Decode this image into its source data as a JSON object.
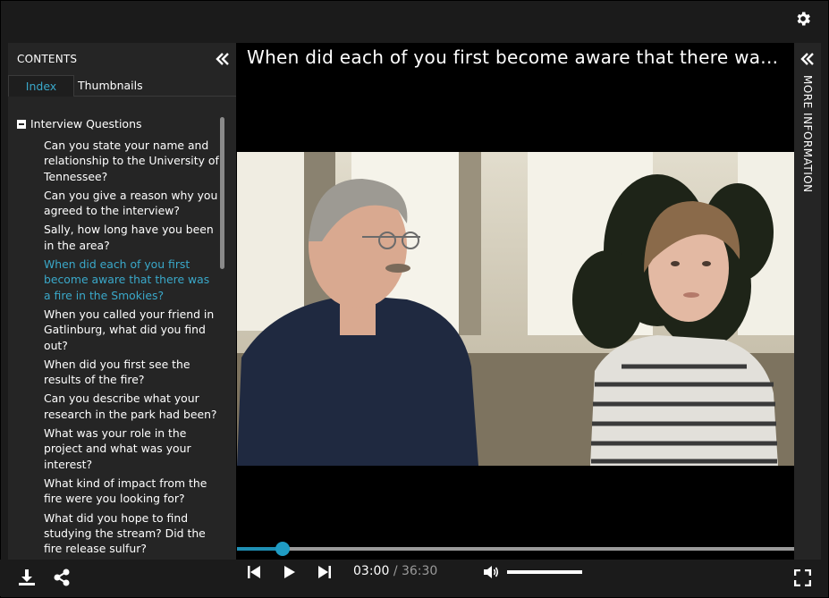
{
  "header": {
    "settings_icon": "gear-icon"
  },
  "sidebar": {
    "heading": "CONTENTS",
    "tabs": [
      {
        "label": "Index",
        "active": true
      },
      {
        "label": "Thumbnails",
        "active": false
      }
    ],
    "group": "Interview Questions",
    "items": [
      {
        "label": "Can you state your name and relationship to the University of Tennessee?",
        "active": false
      },
      {
        "label": "Can you give a reason why you agreed to the interview?",
        "active": false
      },
      {
        "label": "Sally, how long have you been in the area?",
        "active": false
      },
      {
        "label": "When did each of you first become aware that there was a fire in the Smokies?",
        "active": true
      },
      {
        "label": "When you called your friend in Gatlinburg, what did you find out?",
        "active": false
      },
      {
        "label": "When did you first see the results of the fire?",
        "active": false
      },
      {
        "label": "Can you describe what your research in the park had been?",
        "active": false
      },
      {
        "label": "What was your role in the project and what was your interest?",
        "active": false
      },
      {
        "label": "What kind of impact from the fire were you looking for?",
        "active": false
      },
      {
        "label": "What did you hope to find studying the stream? Did the fire release sulfur?",
        "active": false
      }
    ]
  },
  "main": {
    "title": "When did each of you first become aware that there wa..."
  },
  "info_panel": {
    "label": "MORE INFORMATION"
  },
  "player": {
    "current_time": "03:00",
    "separator": "/",
    "duration": "36:30",
    "progress_fraction": 0.0822,
    "volume_fraction": 1.0
  },
  "colors": {
    "accent": "#3aa8c9",
    "progress": "#1f9cc4"
  }
}
